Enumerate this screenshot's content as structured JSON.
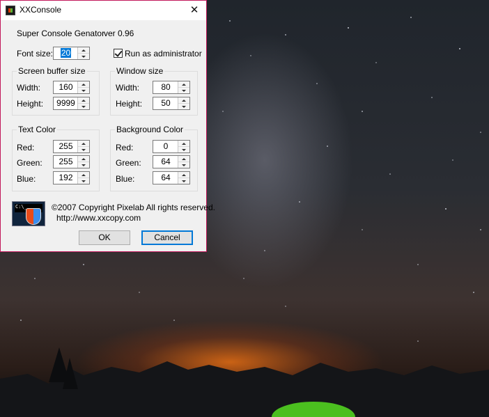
{
  "window": {
    "title": "XXConsole",
    "close_glyph": "✕",
    "app_name": "Super Console Genator",
    "version": "ver 0.96",
    "font_size": {
      "label": "Font size:",
      "value": "20"
    },
    "run_as_admin": {
      "label": "Run as administrator",
      "checked": true
    },
    "screen_buffer": {
      "title": "Screen buffer size",
      "width_label": "Width:",
      "width": "160",
      "height_label": "Height:",
      "height": "9999"
    },
    "window_size": {
      "title": "Window size",
      "width_label": "Width:",
      "width": "80",
      "height_label": "Height:",
      "height": "50"
    },
    "text_color": {
      "title": "Text Color",
      "red_label": "Red:",
      "red": "255",
      "green_label": "Green:",
      "green": "255",
      "blue_label": "Blue:",
      "blue": "192"
    },
    "background_color": {
      "title": "Background Color",
      "red_label": "Red:",
      "red": "0",
      "green_label": "Green:",
      "green": "64",
      "blue_label": "Blue:",
      "blue": "64"
    },
    "copyright": "©2007 Copyright  Pixelab  All rights reserved.",
    "url": "http://www.xxcopy.com",
    "ok_label": "OK",
    "cancel_label": "Cancel",
    "accent_color": "#0078d7",
    "border_color": "#c2185b"
  }
}
